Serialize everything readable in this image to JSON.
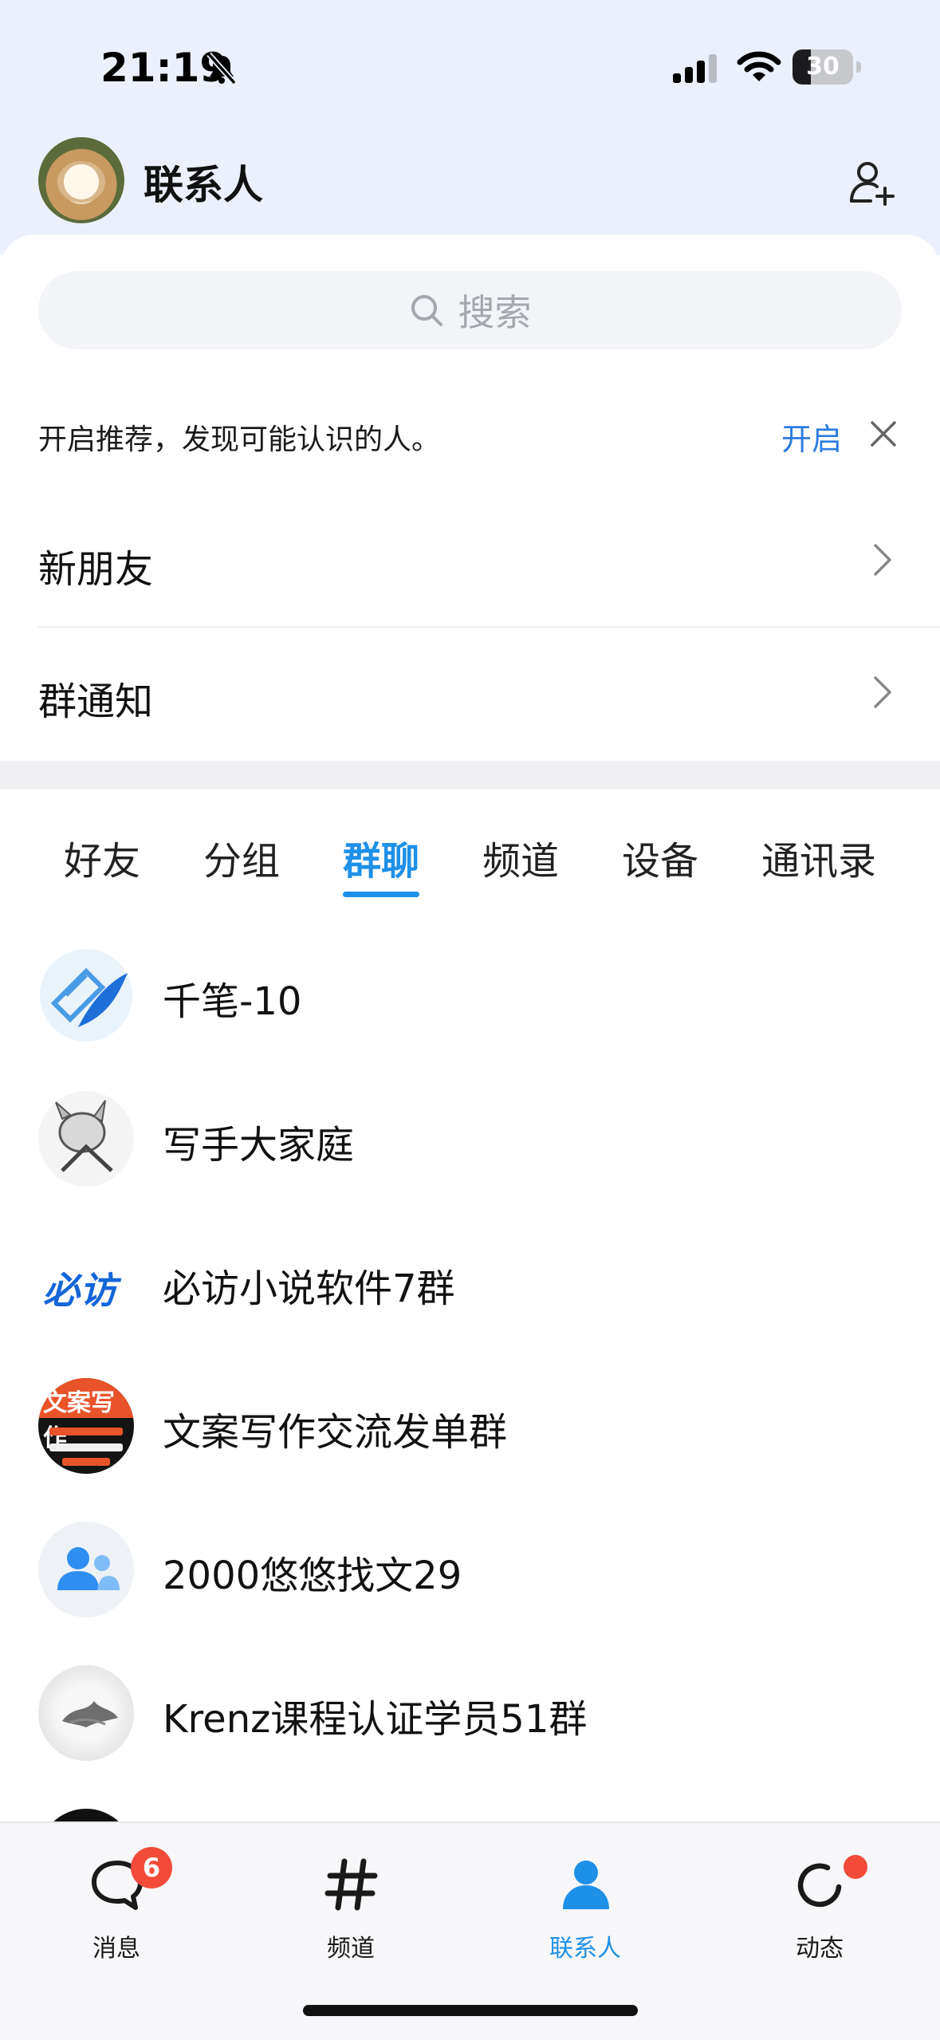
{
  "status_bar": {
    "time": "21:19",
    "battery": "30"
  },
  "header": {
    "title": "联系人"
  },
  "search": {
    "placeholder": "搜索"
  },
  "recommend": {
    "text": "开启推荐，发现可能认识的人。",
    "action": "开启"
  },
  "rows": [
    {
      "label": "新朋友"
    },
    {
      "label": "群通知"
    }
  ],
  "tabs": [
    {
      "label": "好友"
    },
    {
      "label": "分组"
    },
    {
      "label": "群聊",
      "active": true
    },
    {
      "label": "频道"
    },
    {
      "label": "设备"
    },
    {
      "label": "通讯录"
    }
  ],
  "groups": [
    {
      "name": "千笔-10"
    },
    {
      "name": "写手大家庭"
    },
    {
      "name": "必访小说软件7群",
      "avatar_text": "必访"
    },
    {
      "name": "文案写作交流发单群",
      "avatar_text": "文案写作"
    },
    {
      "name": "2000悠悠找文29"
    },
    {
      "name": "Krenz课程认证学员51群"
    }
  ],
  "bottom_nav": [
    {
      "label": "消息",
      "badge": "6"
    },
    {
      "label": "频道"
    },
    {
      "label": "联系人",
      "active": true
    },
    {
      "label": "动态",
      "dot": true
    }
  ],
  "colors": {
    "accent": "#1e90e8",
    "badge": "#f24b3a",
    "link": "#2d7be0"
  }
}
